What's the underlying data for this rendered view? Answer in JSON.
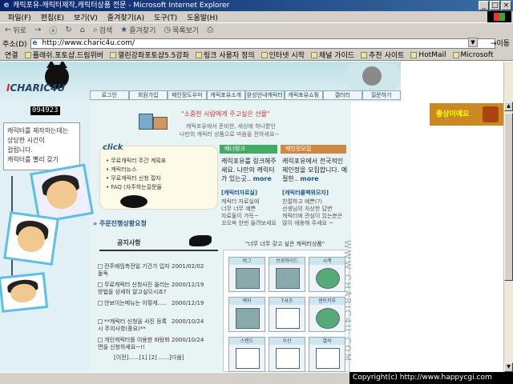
{
  "window": {
    "title": "캐릭포유-캐릭터제작,캐릭터상품 전문 - Microsoft Internet Explorer",
    "controls": [
      "_",
      "□",
      "×"
    ]
  },
  "menu": [
    "파일(F)",
    "편집(E)",
    "보기(V)",
    "즐겨찾기(A)",
    "도구(T)",
    "도움말(H)"
  ],
  "toolbar": {
    "back": "뒤로",
    "forward": "→",
    "stop": "ⓧ",
    "refresh": "↻",
    "home": "⌂",
    "search": "검색",
    "favorites": "즐겨찾기",
    "history": "목록보기",
    "print": "⎙"
  },
  "address": {
    "label": "주소(D)",
    "value": "http://www.charic4u.com/",
    "go": "이동"
  },
  "links": {
    "label": "연결",
    "items": [
      "플래쉬.포토샵.드림위버",
      "열린강좌포토샵5.5강좌",
      "링크 사용자 정의",
      "인터넷 시작",
      "채널 가이드",
      "추천 사이트",
      "HotMail",
      "Microsoft"
    ]
  },
  "site": {
    "logo_i": "I",
    "logo_rest": "CHARIC4U",
    "nav": [
      "로그인",
      "회원가입",
      "제인정도우미",
      "캐릭포유소개",
      "완성안내캐릭터",
      "캐릭포유쇼핑",
      "갤러리",
      "질문하기"
    ],
    "counter": "094923",
    "left_notice": [
      "캐릭터를 제작하는데는",
      "상당한 시간이",
      "걸립니다.",
      "캐릭터를 빨리 갖기"
    ],
    "slogan": "\"소중한 사람에게 주고싶은 선물\"",
    "sub1": "캐릭포유에서 준비한, 세상에 하나뿐인",
    "sub2": "나만의 캐릭터 상품으로 마음을 전하세요~",
    "badge": "좋상이예요",
    "click_title": "click",
    "click_items": [
      "• 무료캐릭터 주간 계획표",
      "• 캐릭터뉴스",
      "• 무료캐릭터 신청 절차",
      "• FAQ (자주하는질문들"
    ],
    "apply_link": "» 주문진행상황요청",
    "board_title": "공지사항",
    "notices": [
      {
        "title": "전주예임촉전일 기간가 입자 돌독",
        "date": "2001/02/02"
      },
      {
        "title": "무료캐릭터 신청사진 올리는 방법을 상세히 알고싶으시죠?",
        "date": "2000/12/19"
      },
      {
        "title": "안보이는메뉴는 이렇게.....",
        "date": "2000/12/19"
      },
      {
        "title": "**캐릭터 신청을 사진 등록시 주의사항(중요)**",
        "date": "2000/10/24"
      },
      {
        "title": "개인캐릭터를 이용한 바탕화면을 신청하세요~!!",
        "date": "2000/10/24"
      }
    ],
    "pager": "[이전]......[1] [2] ......[다음]",
    "panels": [
      {
        "head": "배너링크",
        "text": "캐릭포유를 링크해주세요. 나만의 캐릭터 가 있는곳..",
        "more": "more",
        "sub_head": "[캐릭터자료실]",
        "sub_text": [
          "캐릭터 자료실에",
          "너무 너무 예쁜",
          "자료들이 가득~",
          "꼬오옥 한번 들려보세요"
        ]
      },
      {
        "head": "제인정모집",
        "text": "캐릭포유에서 전국적인 제인정을 모집합니다. 예절한..",
        "more": "more",
        "sub_head": "[캐릭터를벡위모자]",
        "sub_text": [
          "친절하고 예쁜(?)",
          "선생님의 자상한 답변",
          "캐릭터에 관심이 있는분은",
          "많이 애용해 주세요 ~"
        ]
      }
    ],
    "products_title": "\"너무 너무 갖고 싶은 캐릭터상품\"",
    "products": [
      "머그",
      "브로마이드",
      "시계",
      "액자",
      "T셔츠",
      "센트키부",
      "스탠드",
      "우산",
      "열쇠"
    ],
    "vertical_url": "WWW.CHARIC4U.COM",
    "copyright": "Copyright(c) http://www.happycgi.com"
  }
}
